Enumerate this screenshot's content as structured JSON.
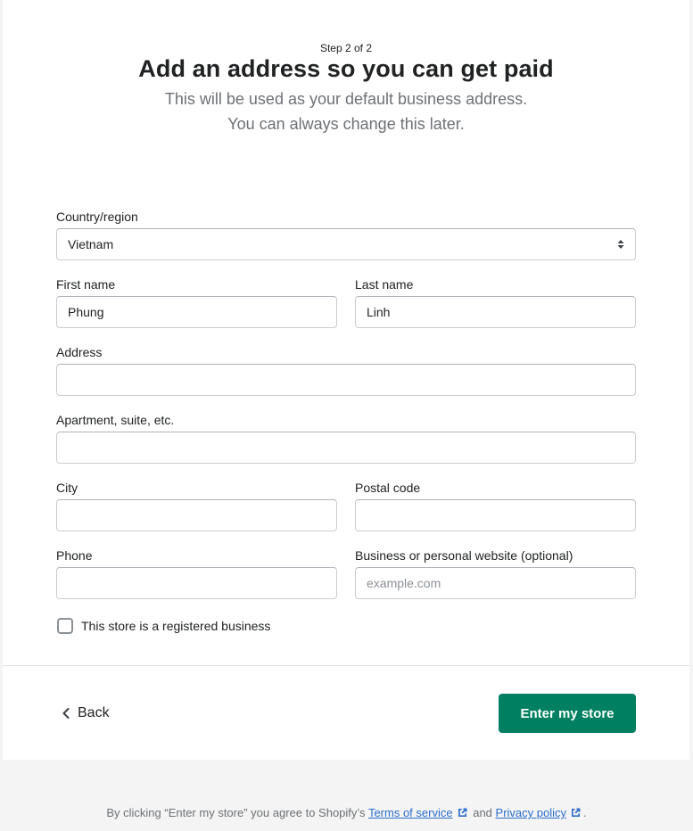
{
  "header": {
    "step": "Step 2 of 2",
    "title": "Add an address so you can get paid",
    "subtitle_line1": "This will be used as your default business address.",
    "subtitle_line2": "You can always change this later."
  },
  "form": {
    "country": {
      "label": "Country/region",
      "value": "Vietnam"
    },
    "first_name": {
      "label": "First name",
      "value": "Phung",
      "placeholder": ""
    },
    "last_name": {
      "label": "Last name",
      "value": "Linh",
      "placeholder": ""
    },
    "address": {
      "label": "Address",
      "value": "",
      "placeholder": ""
    },
    "apartment": {
      "label": "Apartment, suite, etc.",
      "value": "",
      "placeholder": ""
    },
    "city": {
      "label": "City",
      "value": "",
      "placeholder": ""
    },
    "postal_code": {
      "label": "Postal code",
      "value": "",
      "placeholder": ""
    },
    "phone": {
      "label": "Phone",
      "value": "",
      "placeholder": ""
    },
    "website": {
      "label": "Business or personal website (optional)",
      "value": "",
      "placeholder": "example.com"
    },
    "registered_business": {
      "label": "This store is a registered business",
      "checked": false
    }
  },
  "actions": {
    "back_label": "Back",
    "submit_label": "Enter my store",
    "primary_color": "#008060"
  },
  "footer": {
    "prefix": "By clicking “Enter my store” you agree to Shopify’s",
    "terms_label": "Terms of service",
    "and": "and",
    "privacy_label": "Privacy policy",
    "suffix": ".",
    "link_color": "#2c6ecb"
  }
}
